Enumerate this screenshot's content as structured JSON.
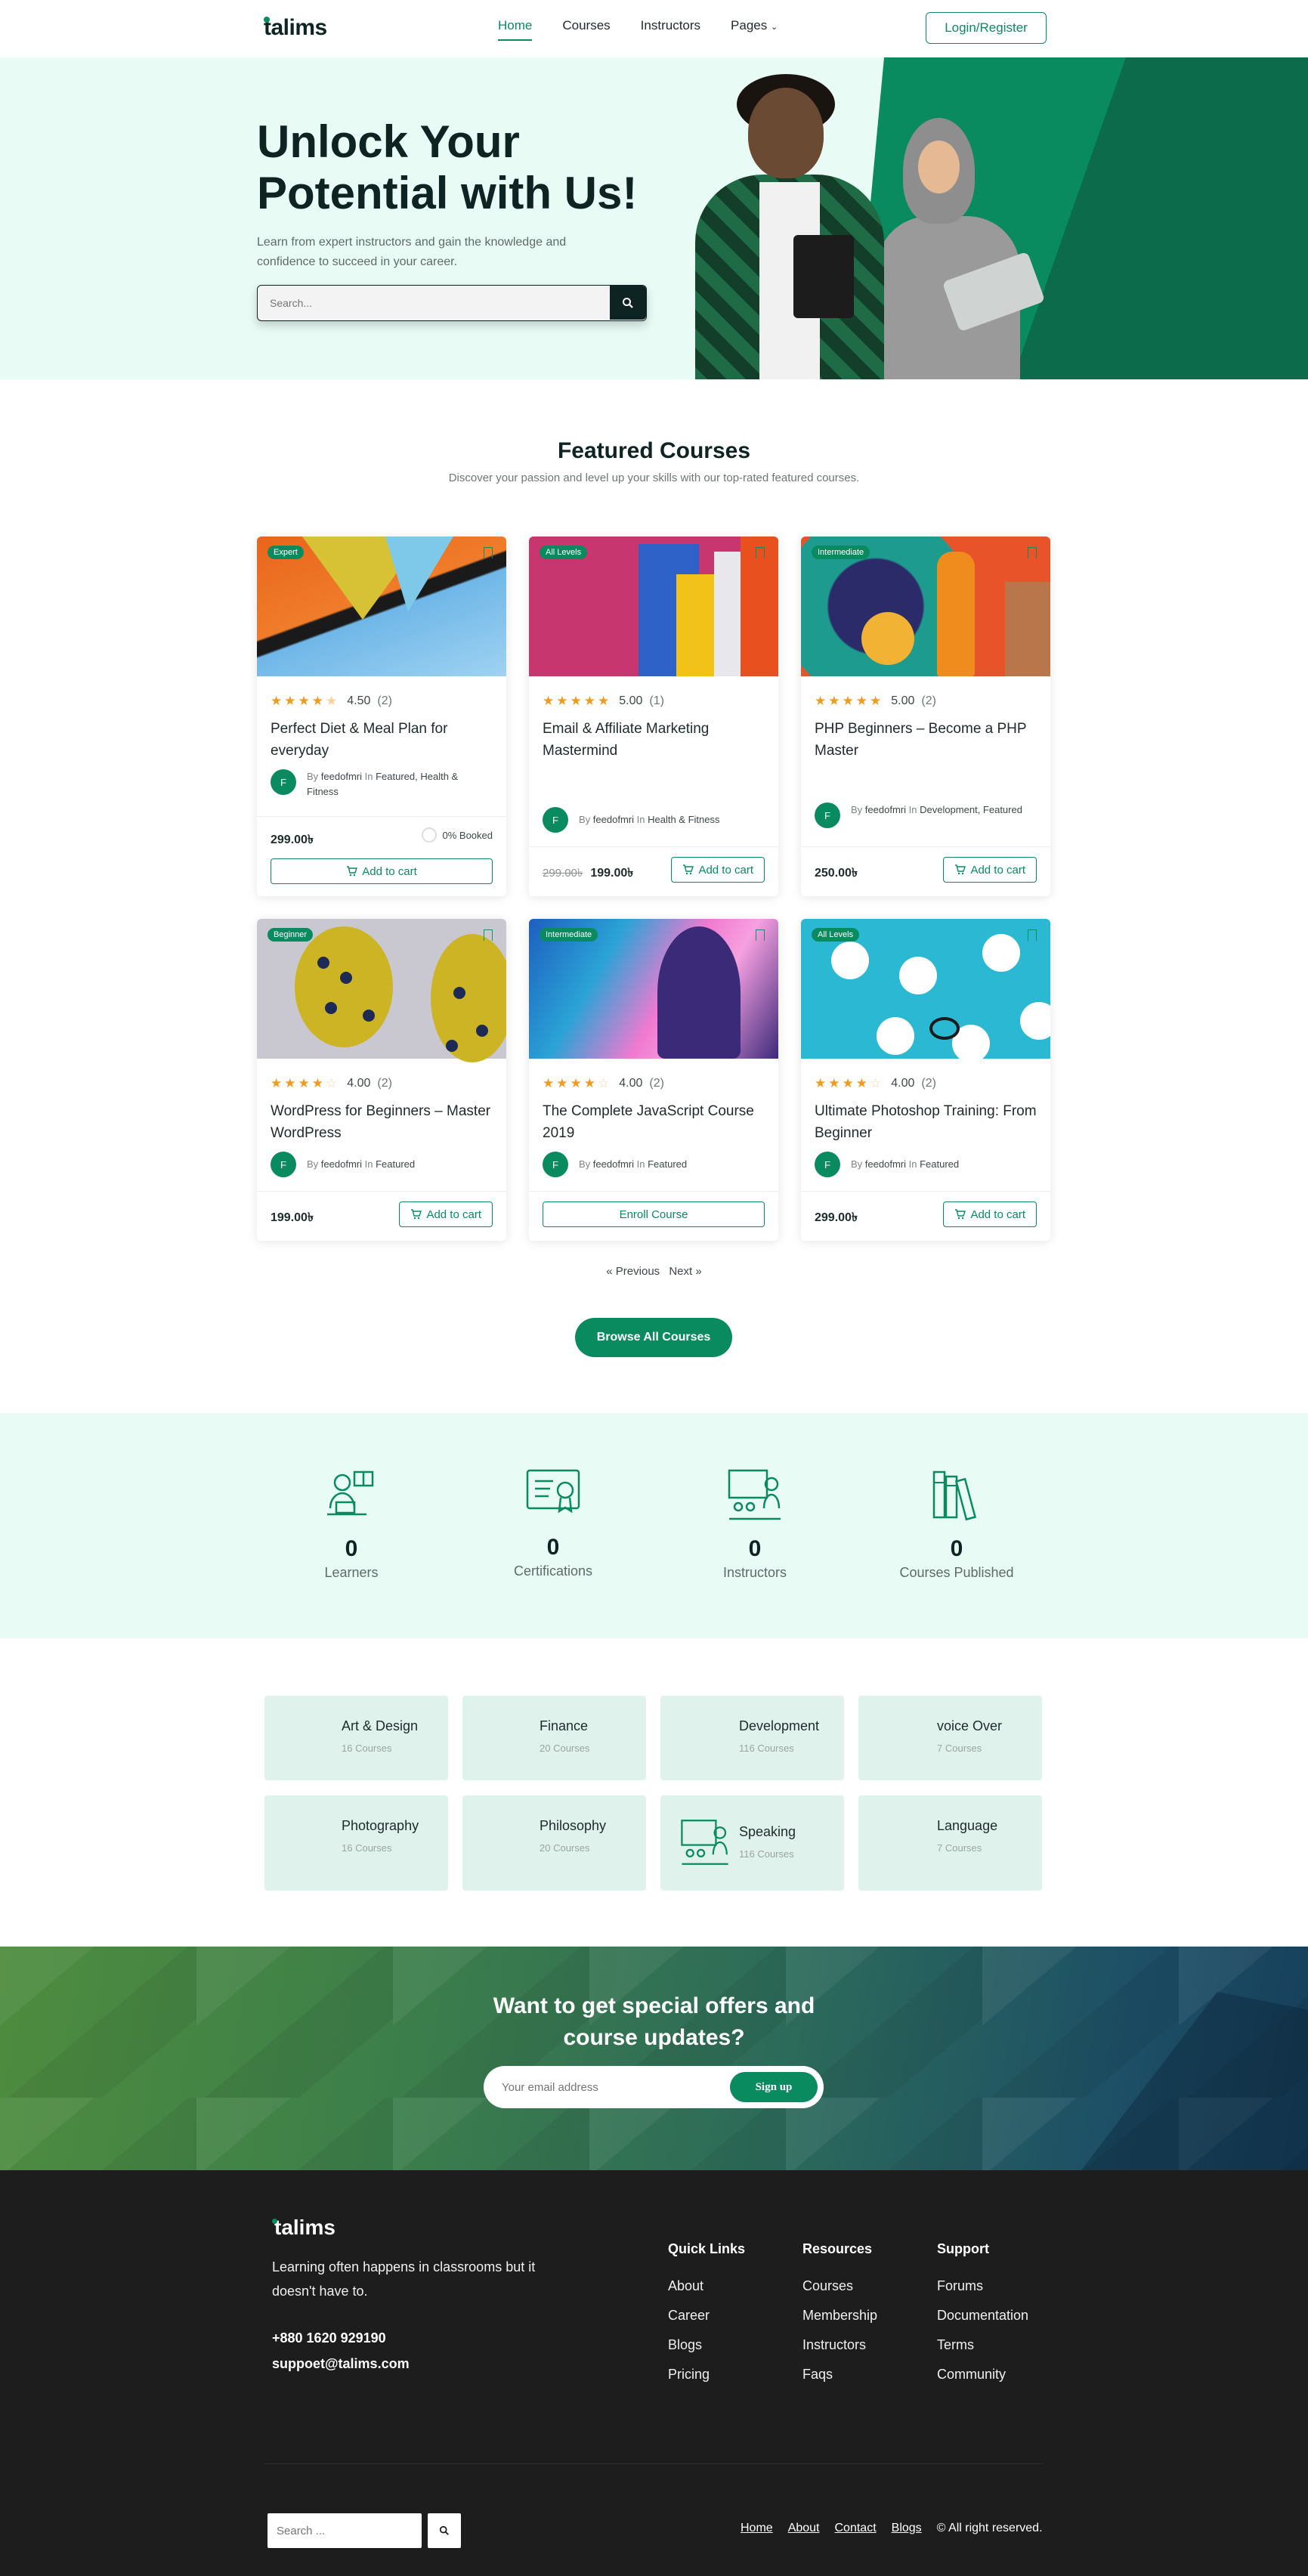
{
  "header": {
    "logo": "talims",
    "nav": [
      {
        "label": "Home",
        "active": true
      },
      {
        "label": "Courses"
      },
      {
        "label": "Instructors"
      },
      {
        "label": "Pages"
      }
    ],
    "login_label": "Login/Register"
  },
  "hero": {
    "title": "Unlock Your Potential with Us!",
    "subtitle": "Learn from expert instructors and gain the knowledge and confidence to succeed in your career.",
    "search_placeholder": "Search..."
  },
  "featured": {
    "title": "Featured Courses",
    "subtitle": "Discover your passion and level up your skills with our top-rated featured courses.",
    "courses": [
      {
        "badge": "Expert",
        "rating": "4.50",
        "stars": 4.5,
        "count": "(2)",
        "title": "Perfect Diet & Meal Plan for everyday",
        "author": "feedofmri",
        "category": "Featured, Health & Fitness",
        "price": "299.00৳",
        "old_price": "",
        "action": "Add to cart",
        "booked": "0% Booked"
      },
      {
        "badge": "All Levels",
        "rating": "5.00",
        "stars": 5,
        "count": "(1)",
        "title": "Email & Affiliate Marketing Mastermind",
        "author": "feedofmri",
        "category": "Health & Fitness",
        "price": "199.00৳",
        "old_price": "299.00৳",
        "action": "Add to cart"
      },
      {
        "badge": "Intermediate",
        "rating": "5.00",
        "stars": 5,
        "count": "(2)",
        "title": "PHP Beginners – Become a PHP Master",
        "author": "feedofmri",
        "category": "Development, Featured",
        "price": "250.00৳",
        "old_price": "",
        "action": "Add to cart"
      },
      {
        "badge": "Beginner",
        "rating": "4.00",
        "stars": 4,
        "count": "(2)",
        "title": "WordPress for Beginners – Master WordPress",
        "author": "feedofmri",
        "category": "Featured",
        "price": "199.00৳",
        "old_price": "",
        "action": "Add to cart"
      },
      {
        "badge": "Intermediate",
        "rating": "4.00",
        "stars": 4,
        "count": "(2)",
        "title": "The Complete JavaScript Course 2019",
        "author": "feedofmri",
        "category": "Featured",
        "price": "",
        "old_price": "",
        "action": "Enroll Course"
      },
      {
        "badge": "All Levels",
        "rating": "4.00",
        "stars": 4,
        "count": "(2)",
        "title": "Ultimate Photoshop Training: From Beginner",
        "author": "feedofmri",
        "category": "Featured",
        "price": "299.00৳",
        "old_price": "",
        "action": "Add to cart"
      }
    ],
    "by_label": "By",
    "in_label": "In",
    "avatar_letter": "F",
    "pager_prev": "« Previous",
    "pager_next": "Next »",
    "browse_label": "Browse All Courses"
  },
  "stats": [
    {
      "value": "0",
      "label": "Learners",
      "icon": "learner-icon"
    },
    {
      "value": "0",
      "label": "Certifications",
      "icon": "certificate-icon"
    },
    {
      "value": "0",
      "label": "Instructors",
      "icon": "instructor-icon"
    },
    {
      "value": "0",
      "label": "Courses Published",
      "icon": "books-icon"
    }
  ],
  "categories": [
    {
      "name": "Art & Design",
      "count": "16 Courses"
    },
    {
      "name": "Finance",
      "count": "20 Courses"
    },
    {
      "name": "Development",
      "count": "116 Courses"
    },
    {
      "name": "voice Over",
      "count": "7 Courses"
    },
    {
      "name": "Photography",
      "count": "16 Courses"
    },
    {
      "name": "Philosophy",
      "count": "20 Courses"
    },
    {
      "name": "Speaking",
      "count": "116 Courses"
    },
    {
      "name": "Language",
      "count": "7 Courses"
    }
  ],
  "newsletter": {
    "title_line1": "Want to get special offers and",
    "title_line2": "course updates?",
    "placeholder": "Your email address",
    "signup_label": "Sign up"
  },
  "footer": {
    "logo": "talims",
    "tagline": "Learning often happens in classrooms but it doesn't have to.",
    "phone": "+880 1620 929190",
    "email": "suppoet@talims.com",
    "columns": [
      {
        "title": "Quick Links",
        "links": [
          "About",
          "Career",
          "Blogs",
          "Pricing"
        ]
      },
      {
        "title": "Resources",
        "links": [
          "Courses",
          "Membership",
          "Instructors",
          "Faqs"
        ]
      },
      {
        "title": "Support",
        "links": [
          "Forums",
          "Documentation",
          "Terms",
          "Community"
        ]
      }
    ],
    "search_placeholder": "Search ...",
    "bottom_links": [
      "Home",
      "About",
      "Contact",
      "Blogs"
    ],
    "copyright": "© All right reserved."
  },
  "colors": {
    "brand": "#0a8a5f",
    "dark": "#0d2422",
    "hero_bg": "#e9fbf5",
    "footer_bg": "#1d1d1d",
    "star": "#f29a1d"
  }
}
